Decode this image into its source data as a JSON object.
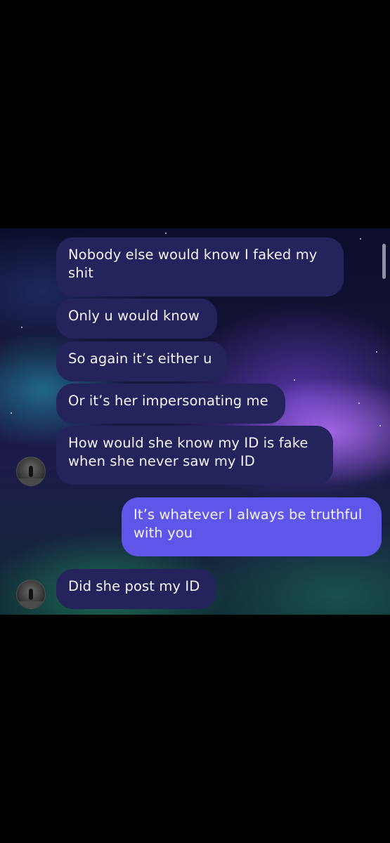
{
  "conversation": {
    "messages": [
      {
        "from": "them",
        "lines": [
          "Nobody else would know I faked my",
          "shit"
        ]
      },
      {
        "from": "them",
        "lines": [
          "Only u would know"
        ]
      },
      {
        "from": "them",
        "lines": [
          "So again it’s either u"
        ]
      },
      {
        "from": "them",
        "lines": [
          "Or it’s her impersonating me"
        ]
      },
      {
        "from": "them",
        "lines": [
          "How would she know my ID is fake",
          "when she never saw my ID"
        ]
      },
      {
        "from": "me",
        "lines": [
          "It’s whatever I always be truthful",
          "with you"
        ]
      },
      {
        "from": "them",
        "lines": [
          "Did she post my ID"
        ]
      }
    ]
  },
  "colors": {
    "incoming_bubble": "#25235c",
    "outgoing_bubble": "#5f56e9",
    "text": "#f2f2f7",
    "outer_background": "#000000"
  },
  "icons": {
    "avatar": "contact-avatar-photo"
  }
}
